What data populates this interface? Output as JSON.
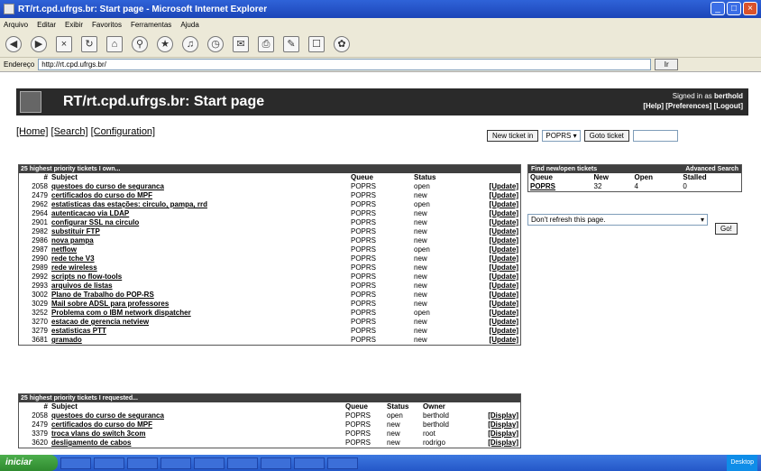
{
  "window": {
    "title": "RT/rt.cpd.ufrgs.br: Start page - Microsoft Internet Explorer",
    "controls": [
      "_",
      "□",
      "×"
    ]
  },
  "menubar": [
    "Arquivo",
    "Editar",
    "Exibir",
    "Favoritos",
    "Ferramentas",
    "Ajuda"
  ],
  "address": {
    "label": "Endereço",
    "url": "http://rt.cpd.ufrgs.br/",
    "go": "Ir"
  },
  "rt": {
    "title": "RT/rt.cpd.ufrgs.br: Start page",
    "signed_in_prefix": "Signed in as",
    "user": "berthold",
    "links": "[Help] [Preferences] [Logout]",
    "nav": {
      "home": "[Home]",
      "search": "[Search]",
      "config": "[Configuration]"
    },
    "new_ticket_btn": "New ticket in",
    "queue_select": "POPRS",
    "goto_btn": "Goto ticket"
  },
  "owned": {
    "title": "25 highest priority tickets I own...",
    "headers": [
      "#",
      "Subject",
      "Queue",
      "Status",
      ""
    ],
    "rows": [
      [
        "2058",
        "questoes do curso de seguranca",
        "POPRS",
        "open",
        "[Update]"
      ],
      [
        "2479",
        "certificados do curso do MPF",
        "POPRS",
        "new",
        "[Update]"
      ],
      [
        "2962",
        "estatisticas das estações: circulo, pampa, rrd",
        "POPRS",
        "open",
        "[Update]"
      ],
      [
        "2964",
        "autenticacao via LDAP",
        "POPRS",
        "new",
        "[Update]"
      ],
      [
        "2901",
        "configurar SSL na circulo",
        "POPRS",
        "new",
        "[Update]"
      ],
      [
        "2982",
        "substituir FTP",
        "POPRS",
        "new",
        "[Update]"
      ],
      [
        "2986",
        "nova pampa",
        "POPRS",
        "new",
        "[Update]"
      ],
      [
        "2987",
        "netflow",
        "POPRS",
        "open",
        "[Update]"
      ],
      [
        "2990",
        "rede tche V3",
        "POPRS",
        "new",
        "[Update]"
      ],
      [
        "2989",
        "rede wireless",
        "POPRS",
        "new",
        "[Update]"
      ],
      [
        "2992",
        "scripts no flow-tools",
        "POPRS",
        "new",
        "[Update]"
      ],
      [
        "2993",
        "arquivos de listas",
        "POPRS",
        "new",
        "[Update]"
      ],
      [
        "3002",
        "Plano de Trabalho do POP-RS",
        "POPRS",
        "new",
        "[Update]"
      ],
      [
        "3029",
        "Mail sobre ADSL para professores",
        "POPRS",
        "new",
        "[Update]"
      ],
      [
        "3252",
        "Problema com o IBM network dispatcher",
        "POPRS",
        "open",
        "[Update]"
      ],
      [
        "3270",
        "estacao de gerencia netview",
        "POPRS",
        "new",
        "[Update]"
      ],
      [
        "3279",
        "estatisticas PTT",
        "POPRS",
        "new",
        "[Update]"
      ],
      [
        "3681",
        "gramado",
        "POPRS",
        "new",
        "[Update]"
      ]
    ]
  },
  "requested": {
    "title": "25 highest priority tickets I requested...",
    "headers": [
      "#",
      "Subject",
      "Queue",
      "Status",
      "Owner",
      ""
    ],
    "rows": [
      [
        "2058",
        "questoes do curso de seguranca",
        "POPRS",
        "open",
        "berthold",
        "[Display]"
      ],
      [
        "2479",
        "certificados do curso do MPF",
        "POPRS",
        "new",
        "berthold",
        "[Display]"
      ],
      [
        "3379",
        "troca vlans do switch 3com",
        "POPRS",
        "new",
        "root",
        "[Display]"
      ],
      [
        "3620",
        "desligamento de cabos",
        "POPRS",
        "new",
        "rodrigo",
        "[Display]"
      ]
    ]
  },
  "quick": {
    "title": "Find new/open tickets",
    "advanced": "Advanced Search",
    "headers": [
      "Queue",
      "New",
      "Open",
      "Stalled"
    ],
    "row": [
      "POPRS",
      "32",
      "4",
      "0"
    ]
  },
  "refresh": {
    "option": "Don't refresh this page.",
    "go": "Go!"
  },
  "taskbar": {
    "start": "iniciar",
    "tasks": [
      "",
      "",
      "",
      "",
      "",
      "",
      "",
      "",
      ""
    ],
    "tray": "Desktop"
  }
}
